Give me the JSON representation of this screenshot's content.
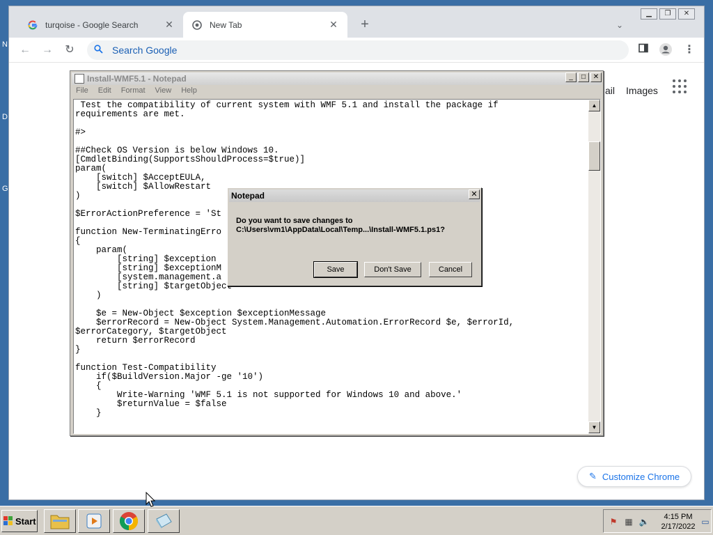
{
  "desktop": {
    "fragments": [
      "N",
      "D",
      "G"
    ]
  },
  "chrome": {
    "tabs": [
      {
        "title": "turqoise - Google Search",
        "favicon": "google-g-icon",
        "active": false
      },
      {
        "title": "New Tab",
        "favicon": "chrome-icon",
        "active": true
      }
    ],
    "omnibox": {
      "placeholder": "Search Google",
      "value": ""
    },
    "ntp": {
      "gmail_partial": "ail",
      "images_label": "Images",
      "customize_label": "Customize Chrome"
    }
  },
  "notepad": {
    "title": "Install-WMF5.1 - Notepad",
    "menu": [
      "File",
      "Edit",
      "Format",
      "View",
      "Help"
    ],
    "content": " Test the compatibility of current system with WMF 5.1 and install the package if\nrequirements are met.\n\n#>\n\n##Check OS Version is below Windows 10.\n[CmdletBinding(SupportsShouldProcess=$true)]\nparam(\n    [switch] $AcceptEULA,\n    [switch] $AllowRestart\n)\n\n$ErrorActionPreference = 'St\n\nfunction New-TerminatingErro\n{\n    param(\n        [string] $exception\n        [string] $exceptionM\n        [system.management.a\n        [string] $targetObject\n    )\n\n    $e = New-Object $exception $exceptionMessage\n    $errorRecord = New-Object System.Management.Automation.ErrorRecord $e, $errorId,\n$errorCategory, $targetObject\n    return $errorRecord\n}\n\nfunction Test-Compatibility\n    if($BuildVersion.Major -ge '10')\n    {\n        Write-Warning 'WMF 5.1 is not supported for Windows 10 and above.'\n        $returnValue = $false\n    }"
  },
  "dialog": {
    "title": "Notepad",
    "message_line1": "Do you want to save changes to",
    "message_line2": "C:\\Users\\vm1\\AppData\\Local\\Temp...\\Install-WMF5.1.ps1?",
    "buttons": {
      "save": "Save",
      "dont_save": "Don't Save",
      "cancel": "Cancel"
    }
  },
  "taskbar": {
    "start_label": "Start",
    "apps": [
      "file-explorer-icon",
      "media-player-icon",
      "chrome-icon",
      "notepad-icon"
    ],
    "clock_time": "4:15 PM",
    "clock_date": "2/17/2022"
  },
  "colors": {
    "accent": "#1a73e8",
    "desktop": "#3a6ea5",
    "classic_face": "#d4d0c8"
  }
}
